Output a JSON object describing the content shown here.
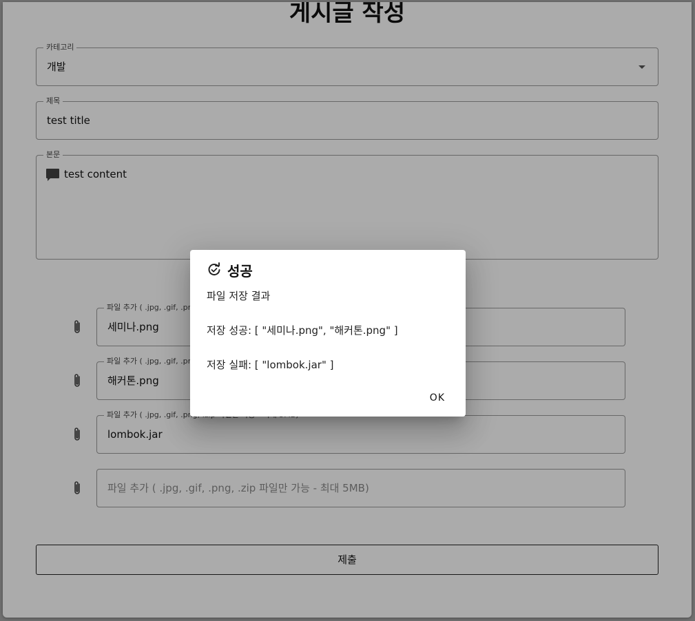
{
  "page": {
    "title": "게시글 작성"
  },
  "form": {
    "category": {
      "label": "카테고리",
      "value": "개발"
    },
    "title": {
      "label": "제목",
      "value": "test title"
    },
    "content": {
      "label": "본문",
      "value": "test content",
      "icon": "comment-icon"
    },
    "files": [
      {
        "label": "파일 추가 ( .jpg, .gif, .pn",
        "value": "세미나.png"
      },
      {
        "label": "파일 추가 ( .jpg, .gif, .pn",
        "value": "해커톤.png"
      },
      {
        "label": "파일 추가 ( .jpg, .gif, .png, .zip 파일만 가능 - 최대 5MB)",
        "value": "lombok.jar"
      }
    ],
    "empty_file_placeholder": "파일 추가 ( .jpg, .gif, .png, .zip 파일만 가능 - 최대 5MB)",
    "submit_label": "제출"
  },
  "dialog": {
    "title": "성공",
    "title_icon": "refresh-check-icon",
    "heading": "파일 저장 결과",
    "success_line": "저장 성공: [ \"세미나.png\", \"해커톤.png\" ]",
    "failure_line": "저장 실패: [ \"lombok.jar\" ]",
    "ok_label": "OK"
  },
  "colors": {
    "backdrop": "#a8a8a8",
    "border": "#9a9a9a",
    "text": "#111111"
  }
}
